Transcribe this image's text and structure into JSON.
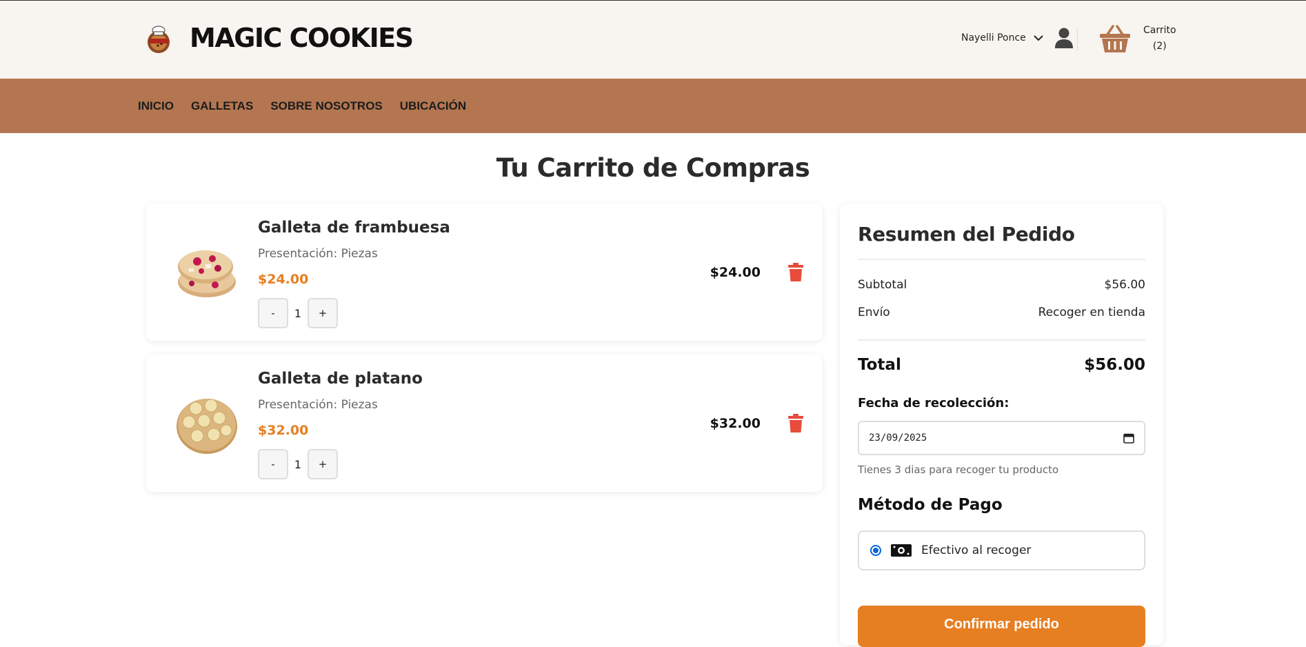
{
  "header": {
    "brand": "MAGIC COOKIES",
    "user_name": "Nayelli Ponce",
    "cart_label": "Carrito",
    "cart_count": "(2)"
  },
  "nav": {
    "items": [
      {
        "label": "INICIO"
      },
      {
        "label": "GALLETAS"
      },
      {
        "label": "SOBRE NOSOTROS"
      },
      {
        "label": "UBICACIÓN"
      }
    ]
  },
  "page": {
    "title": "Tu Carrito de Compras"
  },
  "cart": {
    "items": [
      {
        "name": "Galleta de frambuesa",
        "presentation": "Presentación: Piezas",
        "unit_price": "$24.00",
        "quantity": "1",
        "line_total": "$24.00",
        "minus": "-",
        "plus": "+"
      },
      {
        "name": "Galleta de platano",
        "presentation": "Presentación: Piezas",
        "unit_price": "$32.00",
        "quantity": "1",
        "line_total": "$32.00",
        "minus": "-",
        "plus": "+"
      }
    ]
  },
  "summary": {
    "title": "Resumen del Pedido",
    "subtotal_label": "Subtotal",
    "subtotal_value": "$56.00",
    "shipping_label": "Envío",
    "shipping_value": "Recoger en tienda",
    "total_label": "Total",
    "total_value": "$56.00",
    "pickup_date_label": "Fecha de recolección:",
    "pickup_date_value": "23/09/2025",
    "pickup_hint": "Tienes 3 dias para recoger tu producto",
    "payment_title": "Método de Pago",
    "payment_option": "Efectivo al recoger",
    "confirm_label": "Confirmar pedido"
  },
  "colors": {
    "nav_bg": "#b37650",
    "accent": "#e67e22",
    "trash": "#e74c3c",
    "header_bg": "#f8f4ef"
  }
}
